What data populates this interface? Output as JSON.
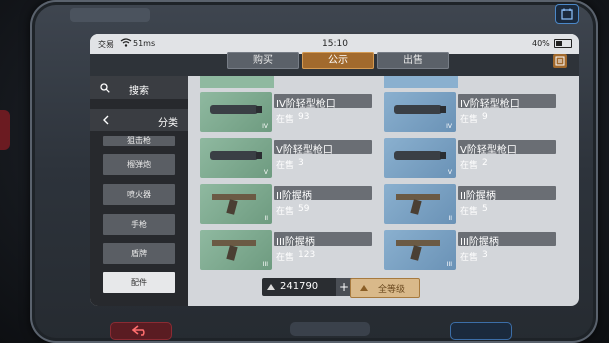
{
  "status": {
    "carrier": "交易",
    "signal": "51ms",
    "time": "15:10",
    "battery": "40%"
  },
  "tabs": [
    {
      "label": "购买",
      "active": false
    },
    {
      "label": "公示",
      "active": true
    },
    {
      "label": "出售",
      "active": false
    }
  ],
  "sidebar": {
    "search_label": "搜索",
    "category_label": "分类",
    "categories": [
      "狙击枪",
      "榴弹炮",
      "喷火器",
      "手枪",
      "盾牌",
      "配件"
    ],
    "selected": "配件"
  },
  "items": [
    {
      "name": "IV阶轻型枪口",
      "stock_label": "在售",
      "stock": "93",
      "tier": "IV",
      "bg": "green"
    },
    {
      "name": "IV阶轻型枪口",
      "stock_label": "在售",
      "stock": "9",
      "tier": "IV",
      "bg": "blue"
    },
    {
      "name": "V阶轻型枪口",
      "stock_label": "在售",
      "stock": "3",
      "tier": "V",
      "bg": "green"
    },
    {
      "name": "V阶轻型枪口",
      "stock_label": "在售",
      "stock": "2",
      "tier": "V",
      "bg": "blue"
    },
    {
      "name": "II阶握柄",
      "stock_label": "在售",
      "stock": "59",
      "tier": "II",
      "bg": "green"
    },
    {
      "name": "II阶握柄",
      "stock_label": "在售",
      "stock": "5",
      "tier": "II",
      "bg": "blue"
    },
    {
      "name": "III阶握柄",
      "stock_label": "在售",
      "stock": "123",
      "tier": "III",
      "bg": "green"
    },
    {
      "name": "III阶握柄",
      "stock_label": "在售",
      "stock": "3",
      "tier": "III",
      "bg": "blue"
    }
  ],
  "currency": {
    "amount": "241790",
    "plus": "+"
  },
  "filter": {
    "level_label": "全等级"
  },
  "colors": {
    "accent": "#a26a2d",
    "green_bg": "#8fb9a0",
    "blue_bg": "#8ab0cf",
    "sidebar": "#27292d"
  },
  "icons": [
    "search-icon",
    "chevron-left-icon",
    "notes-icon",
    "currency-icon",
    "triangle-up-icon",
    "back-icon",
    "calendar-icon"
  ]
}
